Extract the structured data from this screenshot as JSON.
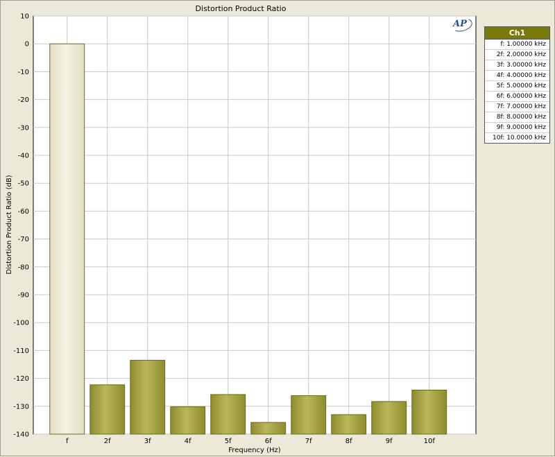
{
  "chart_data": {
    "type": "bar",
    "title": "Distortion Product Ratio",
    "xlabel": "Frequency (Hz)",
    "ylabel": "Distortion Product Ratio (dB)",
    "ylim": [
      -140,
      10
    ],
    "yticks": [
      10,
      0,
      -10,
      -20,
      -30,
      -40,
      -50,
      -60,
      -70,
      -80,
      -90,
      -100,
      -110,
      -120,
      -130,
      -140
    ],
    "grid": true,
    "categories": [
      "f",
      "2f",
      "3f",
      "4f",
      "5f",
      "6f",
      "7f",
      "8f",
      "9f",
      "10f"
    ],
    "series": [
      {
        "name": "Ch1",
        "values": [
          0,
          -122.3,
          -113.5,
          -130.2,
          -125.8,
          -135.8,
          -126.2,
          -133.0,
          -128.3,
          -124.2
        ]
      }
    ],
    "legend_position": "right",
    "colors": {
      "fundamental_fill": "#eae7cf",
      "harmonic_fill": "#a3a03c",
      "bar_stroke": "#6a6a18",
      "grid": "#c8c8c8",
      "plot_bg": "#ffffff",
      "legend_header": "#7a7a0a"
    }
  },
  "legend": {
    "header": "Ch1",
    "entries": [
      "f: 1.00000 kHz",
      "2f: 2.00000 kHz",
      "3f: 3.00000 kHz",
      "4f: 4.00000 kHz",
      "5f: 5.00000 kHz",
      "6f: 6.00000 kHz",
      "7f: 7.00000 kHz",
      "8f: 8.00000 kHz",
      "9f: 9.00000 kHz",
      "10f: 10.0000 kHz"
    ]
  },
  "logo": {
    "text": "AP",
    "icon": "ap-logo-icon"
  }
}
